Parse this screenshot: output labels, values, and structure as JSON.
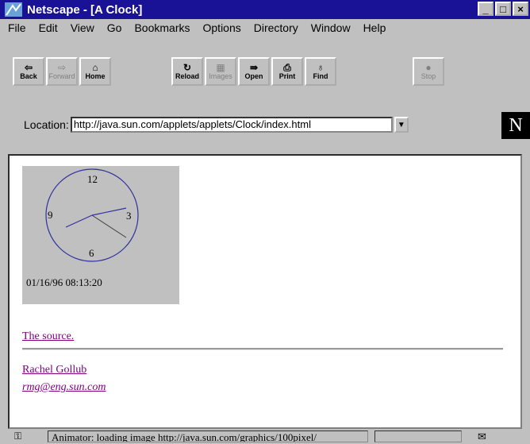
{
  "window": {
    "title": "Netscape - [A Clock]",
    "minimize": "_",
    "maximize": "□",
    "close": "×"
  },
  "menu": [
    "File",
    "Edit",
    "View",
    "Go",
    "Bookmarks",
    "Options",
    "Directory",
    "Window",
    "Help"
  ],
  "toolbar": {
    "back": "Back",
    "forward": "Forward",
    "home": "Home",
    "reload": "Reload",
    "images": "Images",
    "open": "Open",
    "print": "Print",
    "find": "Find",
    "stop": "Stop"
  },
  "location": {
    "label": "Location:",
    "url": "http://java.sun.com/applets/applets/Clock/index.html"
  },
  "logo": "N",
  "page": {
    "clock": {
      "n12": "12",
      "n3": "3",
      "n6": "6",
      "n9": "9",
      "datetime": "01/16/96 08:13:20"
    },
    "source_link": "The source.",
    "author": "Rachel Gollub",
    "email": "rmg@eng.sun.com"
  },
  "status": {
    "text": "Animator: loading image http://java.sun.com/graphics/100pixel/"
  }
}
